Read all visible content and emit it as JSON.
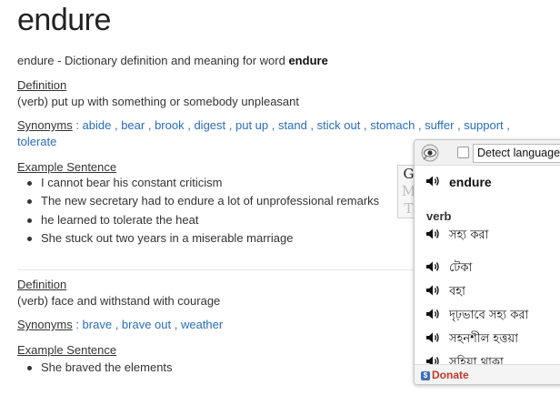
{
  "word": "endure",
  "intro": {
    "prefix": "endure - Dictionary definition and meaning for word ",
    "word": "endure"
  },
  "definitions": [
    {
      "heading": "Definition",
      "text": "(verb) put up with something or somebody unpleasant",
      "synonyms_label": "Synonyms",
      "synonyms": [
        "abide",
        "bear",
        "brook",
        "digest",
        "put up",
        "stand",
        "stick out",
        "stomach",
        "suffer",
        "support",
        "tolerate"
      ],
      "example_heading": "Example Sentence",
      "examples": [
        "I cannot bear his constant criticism",
        "The new secretary had to endure a lot of unprofessional remarks",
        "he learned to tolerate the heat",
        "She stuck out two years in a miserable marriage"
      ]
    },
    {
      "heading": "Definition",
      "text": "(verb) face and withstand with courage",
      "synonyms_label": "Synonyms",
      "synonyms": [
        "brave",
        "brave out",
        "weather"
      ],
      "example_heading": "Example Sentence",
      "examples": [
        "She braved the elements"
      ]
    }
  ],
  "translator": {
    "detect_label": "Detect language",
    "tabs": [
      "G",
      "M",
      "T"
    ],
    "headword": "endure",
    "part_of_speech": "verb",
    "translations": [
      "সহ্য করা",
      "টেকা",
      "বহা",
      "দৃঢ়ভাবে সহ্য করা",
      "সহনশীল হত্তয়া",
      "সহিয়া থাকা"
    ],
    "donate_label": "Donate",
    "donate_icon": "$"
  },
  "colors": {
    "link": "#2a6db5",
    "donate": "#c0392b"
  }
}
